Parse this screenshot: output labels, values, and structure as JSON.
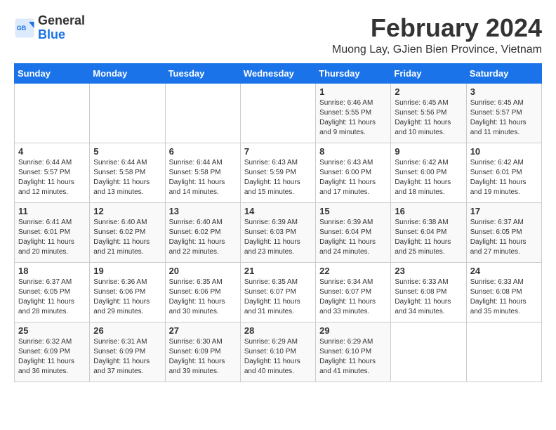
{
  "logo": {
    "text_general": "General",
    "text_blue": "Blue"
  },
  "title": {
    "month_year": "February 2024",
    "location": "Muong Lay, GJien Bien Province, Vietnam"
  },
  "headers": [
    "Sunday",
    "Monday",
    "Tuesday",
    "Wednesday",
    "Thursday",
    "Friday",
    "Saturday"
  ],
  "weeks": [
    [
      {
        "day": "",
        "info": ""
      },
      {
        "day": "",
        "info": ""
      },
      {
        "day": "",
        "info": ""
      },
      {
        "day": "",
        "info": ""
      },
      {
        "day": "1",
        "info": "Sunrise: 6:46 AM\nSunset: 5:55 PM\nDaylight: 11 hours\nand 9 minutes."
      },
      {
        "day": "2",
        "info": "Sunrise: 6:45 AM\nSunset: 5:56 PM\nDaylight: 11 hours\nand 10 minutes."
      },
      {
        "day": "3",
        "info": "Sunrise: 6:45 AM\nSunset: 5:57 PM\nDaylight: 11 hours\nand 11 minutes."
      }
    ],
    [
      {
        "day": "4",
        "info": "Sunrise: 6:44 AM\nSunset: 5:57 PM\nDaylight: 11 hours\nand 12 minutes."
      },
      {
        "day": "5",
        "info": "Sunrise: 6:44 AM\nSunset: 5:58 PM\nDaylight: 11 hours\nand 13 minutes."
      },
      {
        "day": "6",
        "info": "Sunrise: 6:44 AM\nSunset: 5:58 PM\nDaylight: 11 hours\nand 14 minutes."
      },
      {
        "day": "7",
        "info": "Sunrise: 6:43 AM\nSunset: 5:59 PM\nDaylight: 11 hours\nand 15 minutes."
      },
      {
        "day": "8",
        "info": "Sunrise: 6:43 AM\nSunset: 6:00 PM\nDaylight: 11 hours\nand 17 minutes."
      },
      {
        "day": "9",
        "info": "Sunrise: 6:42 AM\nSunset: 6:00 PM\nDaylight: 11 hours\nand 18 minutes."
      },
      {
        "day": "10",
        "info": "Sunrise: 6:42 AM\nSunset: 6:01 PM\nDaylight: 11 hours\nand 19 minutes."
      }
    ],
    [
      {
        "day": "11",
        "info": "Sunrise: 6:41 AM\nSunset: 6:01 PM\nDaylight: 11 hours\nand 20 minutes."
      },
      {
        "day": "12",
        "info": "Sunrise: 6:40 AM\nSunset: 6:02 PM\nDaylight: 11 hours\nand 21 minutes."
      },
      {
        "day": "13",
        "info": "Sunrise: 6:40 AM\nSunset: 6:02 PM\nDaylight: 11 hours\nand 22 minutes."
      },
      {
        "day": "14",
        "info": "Sunrise: 6:39 AM\nSunset: 6:03 PM\nDaylight: 11 hours\nand 23 minutes."
      },
      {
        "day": "15",
        "info": "Sunrise: 6:39 AM\nSunset: 6:04 PM\nDaylight: 11 hours\nand 24 minutes."
      },
      {
        "day": "16",
        "info": "Sunrise: 6:38 AM\nSunset: 6:04 PM\nDaylight: 11 hours\nand 25 minutes."
      },
      {
        "day": "17",
        "info": "Sunrise: 6:37 AM\nSunset: 6:05 PM\nDaylight: 11 hours\nand 27 minutes."
      }
    ],
    [
      {
        "day": "18",
        "info": "Sunrise: 6:37 AM\nSunset: 6:05 PM\nDaylight: 11 hours\nand 28 minutes."
      },
      {
        "day": "19",
        "info": "Sunrise: 6:36 AM\nSunset: 6:06 PM\nDaylight: 11 hours\nand 29 minutes."
      },
      {
        "day": "20",
        "info": "Sunrise: 6:35 AM\nSunset: 6:06 PM\nDaylight: 11 hours\nand 30 minutes."
      },
      {
        "day": "21",
        "info": "Sunrise: 6:35 AM\nSunset: 6:07 PM\nDaylight: 11 hours\nand 31 minutes."
      },
      {
        "day": "22",
        "info": "Sunrise: 6:34 AM\nSunset: 6:07 PM\nDaylight: 11 hours\nand 33 minutes."
      },
      {
        "day": "23",
        "info": "Sunrise: 6:33 AM\nSunset: 6:08 PM\nDaylight: 11 hours\nand 34 minutes."
      },
      {
        "day": "24",
        "info": "Sunrise: 6:33 AM\nSunset: 6:08 PM\nDaylight: 11 hours\nand 35 minutes."
      }
    ],
    [
      {
        "day": "25",
        "info": "Sunrise: 6:32 AM\nSunset: 6:09 PM\nDaylight: 11 hours\nand 36 minutes."
      },
      {
        "day": "26",
        "info": "Sunrise: 6:31 AM\nSunset: 6:09 PM\nDaylight: 11 hours\nand 37 minutes."
      },
      {
        "day": "27",
        "info": "Sunrise: 6:30 AM\nSunset: 6:09 PM\nDaylight: 11 hours\nand 39 minutes."
      },
      {
        "day": "28",
        "info": "Sunrise: 6:29 AM\nSunset: 6:10 PM\nDaylight: 11 hours\nand 40 minutes."
      },
      {
        "day": "29",
        "info": "Sunrise: 6:29 AM\nSunset: 6:10 PM\nDaylight: 11 hours\nand 41 minutes."
      },
      {
        "day": "",
        "info": ""
      },
      {
        "day": "",
        "info": ""
      }
    ]
  ]
}
